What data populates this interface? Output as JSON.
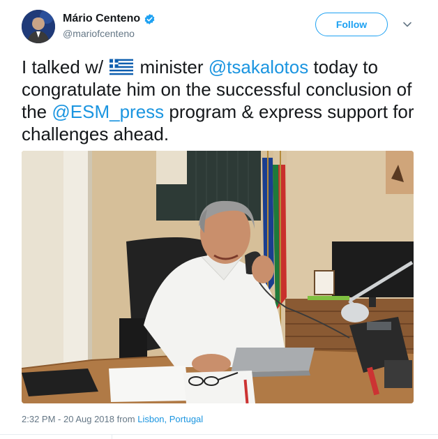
{
  "user": {
    "display_name": "Mário Centeno",
    "handle": "@mariofcenteno",
    "verified": true
  },
  "actions": {
    "follow_label": "Follow",
    "more_icon": "chevron-down-icon"
  },
  "tweet": {
    "text_parts": [
      {
        "type": "text",
        "value": "I talked w/ "
      },
      {
        "type": "emoji",
        "value": "greek-flag-icon"
      },
      {
        "type": "text",
        "value": " minister "
      },
      {
        "type": "mention",
        "value": "@tsakalotos"
      },
      {
        "type": "text",
        "value": " today to congratulate him on the successful conclusion of the "
      },
      {
        "type": "mention",
        "value": "@ESM_press"
      },
      {
        "type": "text",
        "value": " program & express support for challenges ahead."
      }
    ],
    "t1": "I talked w/ ",
    "t2": " minister ",
    "m1": "@tsakalotos",
    "t3": " today to congratulate him on the successful conclusion of the ",
    "m2": "@ESM_press",
    "t4": " program & express support for challenges ahead.",
    "photo_icon": "tweet-photo"
  },
  "meta": {
    "timestamp": "2:32 PM - 20 Aug 2018",
    "from_label": " from ",
    "location": "Lisbon, Portugal"
  },
  "colors": {
    "accent": "#1da1f2",
    "mention": "#1b95e0",
    "secondary_text": "#657786",
    "primary_text": "#14171a"
  }
}
